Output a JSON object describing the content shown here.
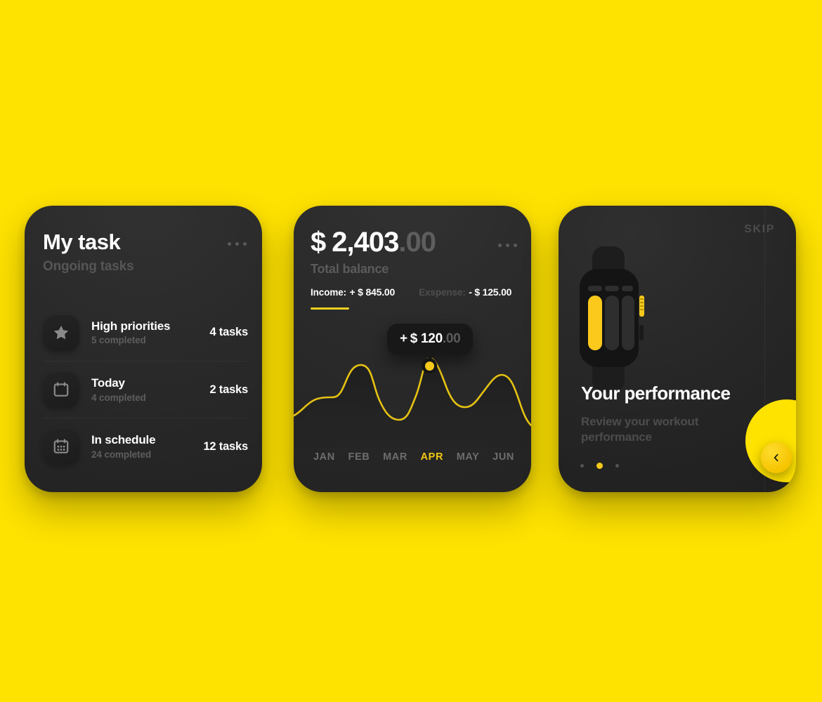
{
  "theme": {
    "background": "#FEE200",
    "card_background": "#2a2a2a",
    "accent": "#F5C91B",
    "text_primary": "#FFFFFF",
    "text_muted": "#5a5a5a"
  },
  "task_card": {
    "title": "My task",
    "subtitle": "Ongoing tasks",
    "menu_icon": "more-horizontal-icon",
    "items": [
      {
        "icon": "star-icon",
        "name": "High priorities",
        "completed": "5 completed",
        "count": "4 tasks"
      },
      {
        "icon": "calendar-icon",
        "name": "Today",
        "completed": "4 completed",
        "count": "2 tasks"
      },
      {
        "icon": "calendar-grid-icon",
        "name": "In schedule",
        "completed": "24 completed",
        "count": "12 tasks"
      }
    ]
  },
  "balance_card": {
    "currency": "$",
    "amount": "2,403",
    "cents": ".00",
    "subtitle": "Total balance",
    "menu_icon": "more-horizontal-icon",
    "stats": [
      {
        "label": "Income:",
        "value": "+ $ 845",
        "cents": ".00",
        "active": true
      },
      {
        "label": "Exspense:",
        "value": "- $ 125",
        "cents": ".00",
        "active": false
      }
    ],
    "tooltip": {
      "plus": "+",
      "value": "$ 120",
      "cents": ".00"
    },
    "months": [
      "JAN",
      "FEB",
      "MAR",
      "APR",
      "MAY",
      "JUN"
    ],
    "active_month": "APR"
  },
  "chart_data": {
    "type": "line",
    "title": "Total balance trend",
    "categories": [
      "JAN",
      "FEB",
      "MAR",
      "APR",
      "MAY",
      "JUN"
    ],
    "x": [
      0,
      1,
      2,
      3,
      4,
      5
    ],
    "values": [
      48,
      76,
      22,
      120,
      58,
      86
    ],
    "highlight_index": 3,
    "highlight_label": "+ $ 120.00",
    "xlabel": "",
    "ylabel": "",
    "ylim": [
      0,
      140
    ],
    "grid": false,
    "legend": "none",
    "line_color": "#E5C213",
    "smoothing": "cubic"
  },
  "performance_card": {
    "skip_label": "SKIP",
    "illustration": "smartwatch-icon",
    "title": "Your performance",
    "subtitle": "Review your workout performance",
    "pagination": {
      "total": 3,
      "active_index": 1
    },
    "next_button_icon": "chevron-left-icon"
  }
}
